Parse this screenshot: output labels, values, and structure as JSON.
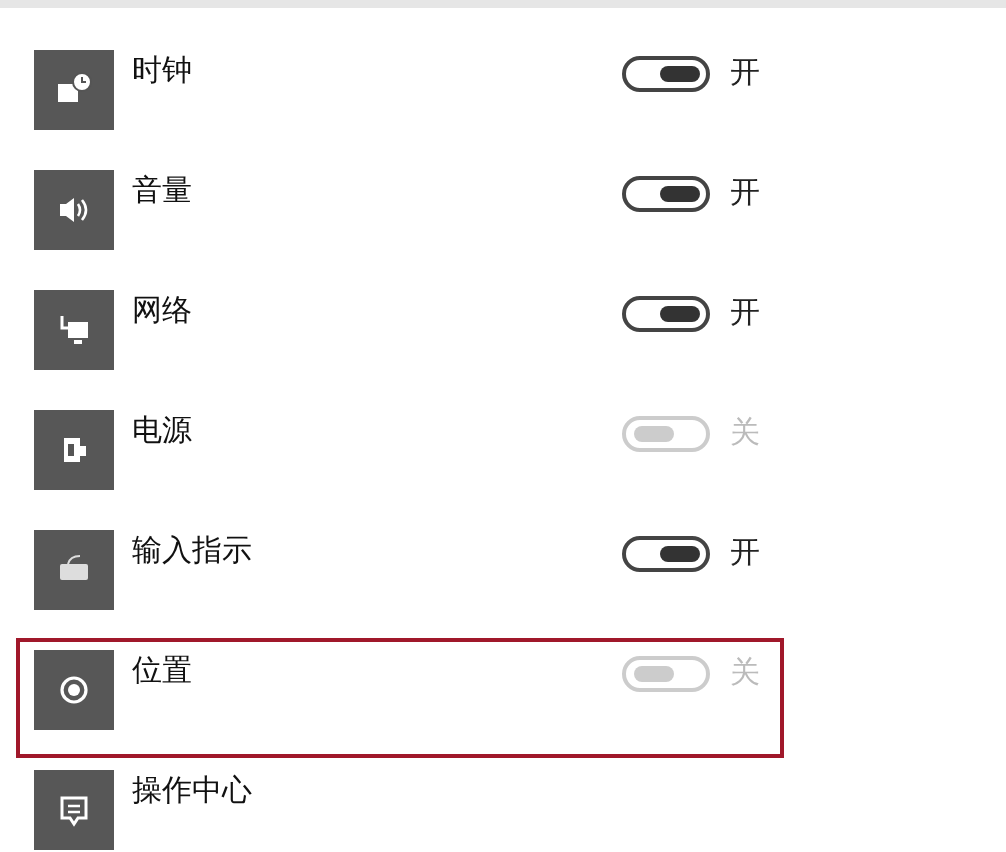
{
  "items": [
    {
      "label": "时钟",
      "on": true,
      "disabled": false,
      "state": "开",
      "highlighted": false
    },
    {
      "label": "音量",
      "on": true,
      "disabled": false,
      "state": "开",
      "highlighted": false
    },
    {
      "label": "网络",
      "on": true,
      "disabled": false,
      "state": "开",
      "highlighted": false
    },
    {
      "label": "电源",
      "on": false,
      "disabled": true,
      "state": "关",
      "highlighted": false
    },
    {
      "label": "输入指示",
      "on": true,
      "disabled": false,
      "state": "开",
      "highlighted": false
    },
    {
      "label": "位置",
      "on": false,
      "disabled": true,
      "state": "关",
      "highlighted": true
    },
    {
      "label": "操作中心",
      "highlighted": false
    }
  ]
}
